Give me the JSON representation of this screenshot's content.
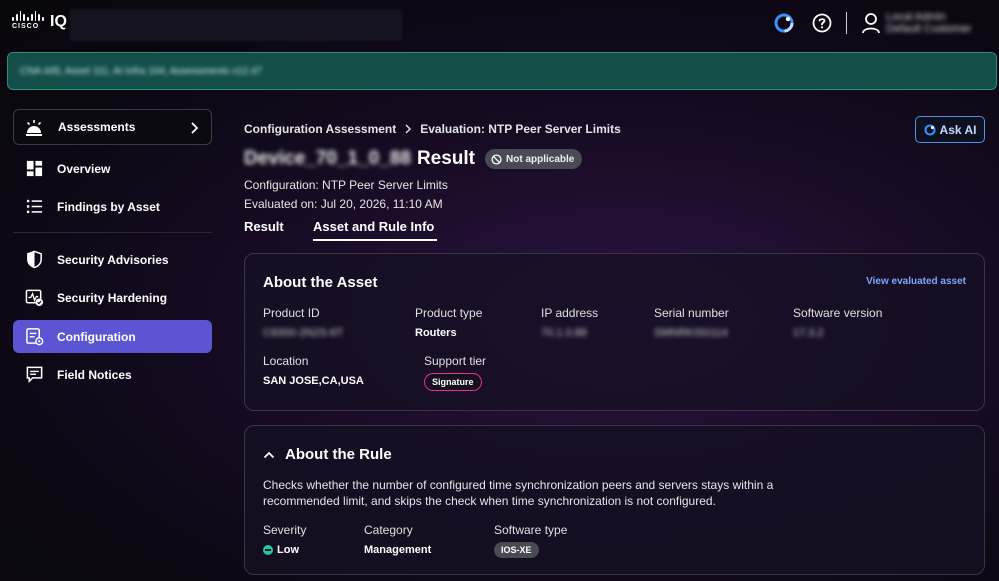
{
  "header": {
    "logo_text": "CISCO",
    "app_name": "IQ",
    "user_name": "Local Admin",
    "user_org": "Default Customer"
  },
  "banner": {
    "text": "CNA 445, Asset 111, AI Infra 104, Assessments v12.47"
  },
  "sidebar": {
    "assessments_label": "Assessments",
    "items": [
      {
        "label": "Overview",
        "icon": "dashboard-icon"
      },
      {
        "label": "Findings by Asset",
        "icon": "list-icon"
      },
      {
        "label": "Security Advisories",
        "icon": "shield-icon"
      },
      {
        "label": "Security Hardening",
        "icon": "hardening-icon"
      },
      {
        "label": "Configuration",
        "icon": "config-icon",
        "active": true
      },
      {
        "label": "Field Notices",
        "icon": "notice-icon"
      }
    ]
  },
  "breadcrumb": {
    "parent": "Configuration Assessment",
    "current": "Evaluation: NTP Peer Server Limits"
  },
  "ask_ai_label": "Ask AI",
  "title": {
    "device": "Device_70_1_0_88",
    "suffix": "Result",
    "status": "Not applicable"
  },
  "meta": {
    "configuration": "Configuration: NTP Peer Server Limits",
    "evaluated": "Evaluated on: Jul 20, 2026, 11:10 AM"
  },
  "tabs": {
    "result": "Result",
    "asset_rule": "Asset and Rule Info"
  },
  "asset": {
    "title": "About the Asset",
    "link": "View evaluated asset",
    "fields": {
      "product_id": {
        "label": "Product ID",
        "value": "C8300-2N2S-6T"
      },
      "product_type": {
        "label": "Product type",
        "value": "Routers"
      },
      "ip_address": {
        "label": "IP address",
        "value": "70.1.0.88"
      },
      "serial_number": {
        "label": "Serial number",
        "value": "SMNRKIS0114"
      },
      "software_version": {
        "label": "Software version",
        "value": "17.3.2"
      },
      "location": {
        "label": "Location",
        "value": "SAN JOSE,CA,USA"
      },
      "support_tier": {
        "label": "Support tier",
        "value": "Signature"
      }
    }
  },
  "rule": {
    "title": "About the Rule",
    "description": "Checks whether the number of configured time synchronization peers and servers stays within a recommended limit, and skips the check when time synchronization is not configured.",
    "severity": {
      "label": "Severity",
      "value": "Low"
    },
    "category": {
      "label": "Category",
      "value": "Management"
    },
    "software_type": {
      "label": "Software type",
      "value": "IOS-XE"
    }
  },
  "colors": {
    "accent": "#5b55d4",
    "banner": "#134f48",
    "link": "#7aa7ff",
    "signature_border": "#e0338e",
    "severity_low": "#27c6a6"
  }
}
